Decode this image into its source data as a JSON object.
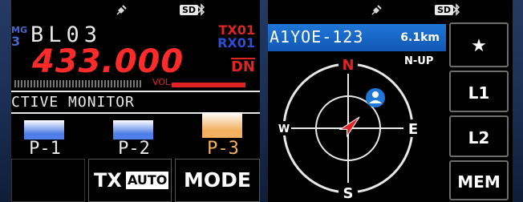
{
  "left_screen": {
    "status": {
      "satellite_icon": "satellite-icon",
      "sd_label": "SD",
      "bluetooth_icon": "bluetooth-icon"
    },
    "memory_group_label": "MG",
    "memory_group_number": "3",
    "channel_name": "BL03",
    "frequency": "433.000",
    "tx_label": "TX01",
    "rx_label": "RX01",
    "mode_indicator": "DN",
    "vol_label": "VOL",
    "vol_level_pct": 100,
    "monitor_text": "CTIVE MONITOR",
    "presets": [
      {
        "label": "P-1",
        "color": "#4f7ee8",
        "label_color": "#e8e8e8"
      },
      {
        "label": "P-2",
        "color": "#4f7ee8",
        "label_color": "#e8e8e8"
      },
      {
        "label": "P-3",
        "color": "#f2b060",
        "label_color": "#f2b060"
      }
    ],
    "buttons": {
      "tx_label": "TX",
      "auto_label": "AUTO",
      "mode_label": "MODE"
    }
  },
  "right_screen": {
    "status": {
      "satellite_icon": "satellite-icon",
      "sd_label": "SD",
      "bluetooth_icon": "bluetooth-icon"
    },
    "callsign": "A1YOE-123",
    "distance": "6.1km",
    "orientation": "N-UP",
    "compass": {
      "north": "N",
      "south": "S",
      "east": "E",
      "west": "W",
      "heading_deg": 45
    },
    "station_icon": "person-icon",
    "side_buttons": {
      "star_label": "★",
      "l1_label": "L1",
      "l2_label": "L2",
      "mem_label": "MEM"
    }
  }
}
